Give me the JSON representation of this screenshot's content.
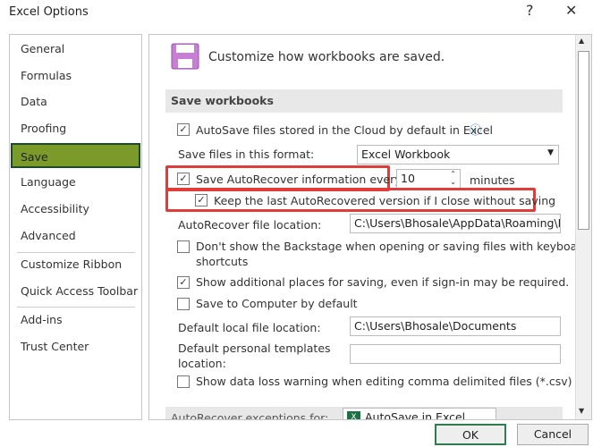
{
  "window": {
    "title": "Excel Options",
    "help": "?",
    "close": "✕"
  },
  "sidebar": {
    "items": [
      "General",
      "Formulas",
      "Data",
      "Proofing",
      "Save",
      "Language",
      "Accessibility",
      "Advanced",
      "Customize Ribbon",
      "Quick Access Toolbar",
      "Add-ins",
      "Trust Center"
    ],
    "selected": "Save"
  },
  "main": {
    "header": "Customize how workbooks are saved.",
    "section": "Save workbooks",
    "autosave_cloud": {
      "label": "AutoSave files stored in the Cloud by default in Excel",
      "checked": true
    },
    "format_label": "Save files in this format:",
    "format_value": "Excel Workbook",
    "autorecover": {
      "label": "Save AutoRecover information every",
      "checked": true,
      "minutes": "10",
      "unit": "minutes"
    },
    "keep_last": {
      "label": "Keep the last AutoRecovered version if I close without saving",
      "checked": true
    },
    "ar_location_label": "AutoRecover file location:",
    "ar_location_value": "C:\\Users\\Bhosale\\AppData\\Roaming\\M",
    "backstage": {
      "label": "Don't show the Backstage when opening or saving files with keyboard",
      "label2": "shortcuts",
      "checked": false
    },
    "additional": {
      "label": "Show additional places for saving, even if sign-in may be required.",
      "checked": true
    },
    "computer": {
      "label": "Save to Computer by default",
      "checked": false
    },
    "local_label": "Default local file location:",
    "local_value": "C:\\Users\\Bhosale\\Documents",
    "templates_label": "Default personal templates",
    "templates_label2": "location:",
    "templates_value": "",
    "csv": {
      "label": "Show data loss warning when editing comma delimited files (*.csv)",
      "checked": false
    },
    "exceptions_label": "AutoRecover exceptions for:",
    "exceptions_value": "AutoSave in Excel"
  },
  "footer": {
    "ok": "OK",
    "cancel": "Cancel"
  },
  "colors": {
    "selected": "#7a9a2a",
    "highlight": "#e03c3c"
  }
}
